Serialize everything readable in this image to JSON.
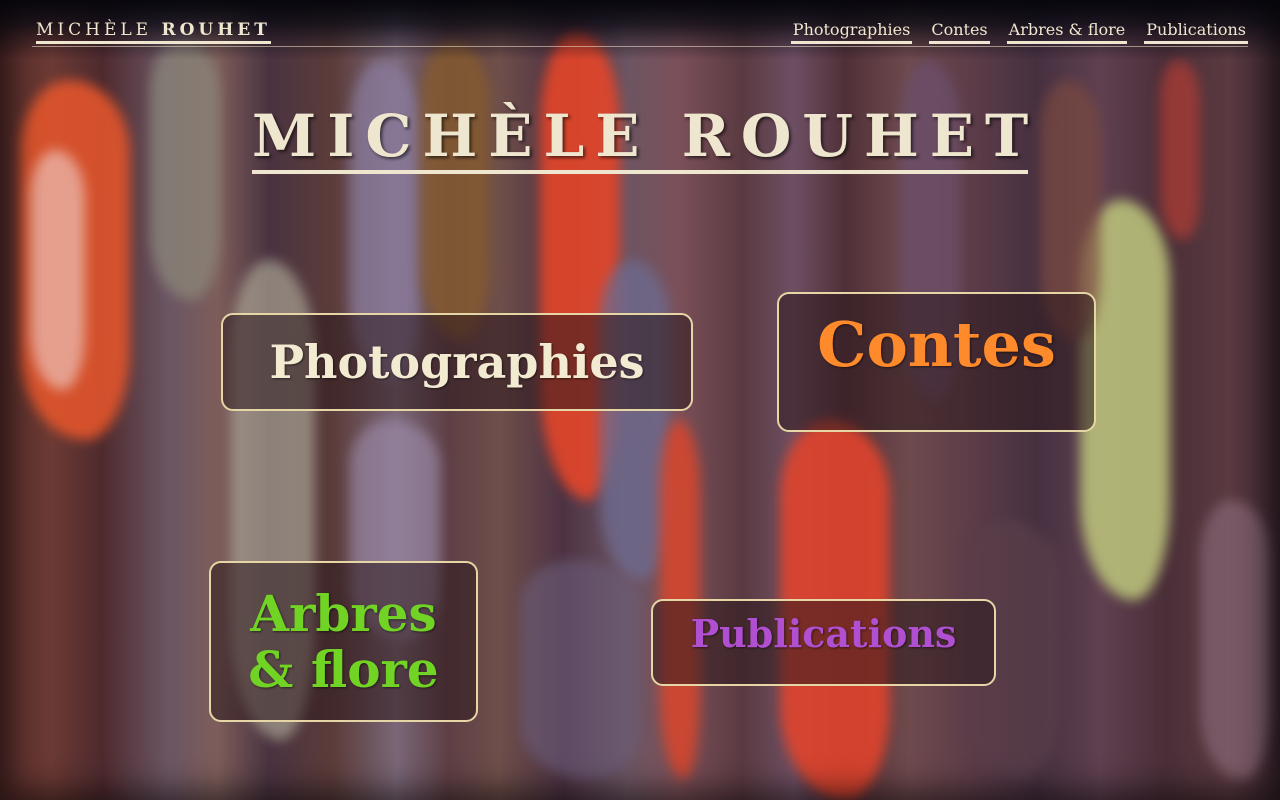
{
  "header": {
    "site_title_light": "MICHÈLE",
    "site_title_bold": "ROUHET",
    "nav": [
      {
        "label": "Photographies"
      },
      {
        "label": "Contes"
      },
      {
        "label": "Arbres & flore"
      },
      {
        "label": "Publications"
      }
    ]
  },
  "hero": {
    "title_light": "MICHÈLE",
    "title_bold": "ROUHET"
  },
  "cards": {
    "photographies": {
      "label": "Photographies",
      "color": "#f3ead2"
    },
    "contes": {
      "label": "Contes",
      "color": "#ff8a2c"
    },
    "arbres_line1": "Arbres",
    "arbres_line2": "& flore",
    "arbres_color": "#71d324",
    "publications": {
      "label": "Publications",
      "color": "#b04fd0"
    }
  },
  "colors": {
    "cream": "#efe6cf",
    "card_border": "#e6d6a6"
  }
}
